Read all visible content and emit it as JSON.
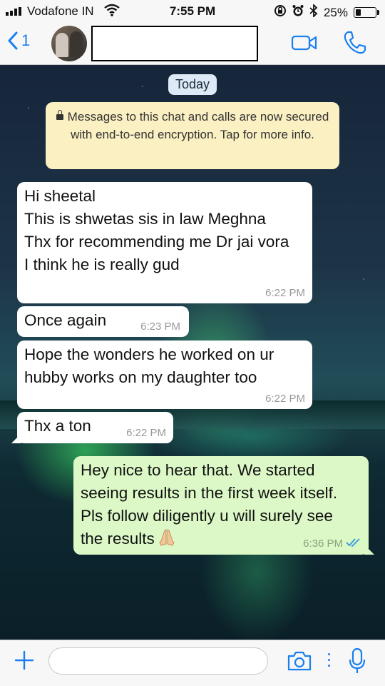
{
  "status_bar": {
    "carrier": "Vodafone IN",
    "time": "7:55 PM",
    "battery_percent": "25%",
    "battery_level": 0.25
  },
  "nav": {
    "back_count": "1",
    "contact_name": ""
  },
  "chat": {
    "date_pill": "Today",
    "encryption_notice": "Messages to this chat and calls are now secured with end-to-end encryption. Tap for more info.",
    "messages": [
      {
        "direction": "incoming",
        "text": "Hi sheetal\nThis is shwetas  sis in law Meghna\nThx for recommending me Dr jai vora\nI think he is really gud",
        "time": "6:22 PM"
      },
      {
        "direction": "incoming",
        "text": "Once again",
        "time": "6:23 PM"
      },
      {
        "direction": "incoming",
        "text": "Hope the wonders he worked on ur hubby works on my daughter too",
        "time": "6:22 PM"
      },
      {
        "direction": "incoming",
        "text": "Thx a ton",
        "time": "6:22 PM"
      },
      {
        "direction": "outgoing",
        "text": "Hey nice to hear that. We started seeing results in the first week itself. Pls follow diligently u will surely see the results",
        "emoji": "praying-hands",
        "time": "6:36 PM",
        "status": "read"
      }
    ]
  },
  "input": {
    "placeholder": ""
  },
  "colors": {
    "accent": "#1a7ff0",
    "incoming_bubble": "#ffffff",
    "outgoing_bubble": "#dcf8c6",
    "notice_bubble": "#fbf0c2",
    "date_pill": "#dde9f6"
  }
}
